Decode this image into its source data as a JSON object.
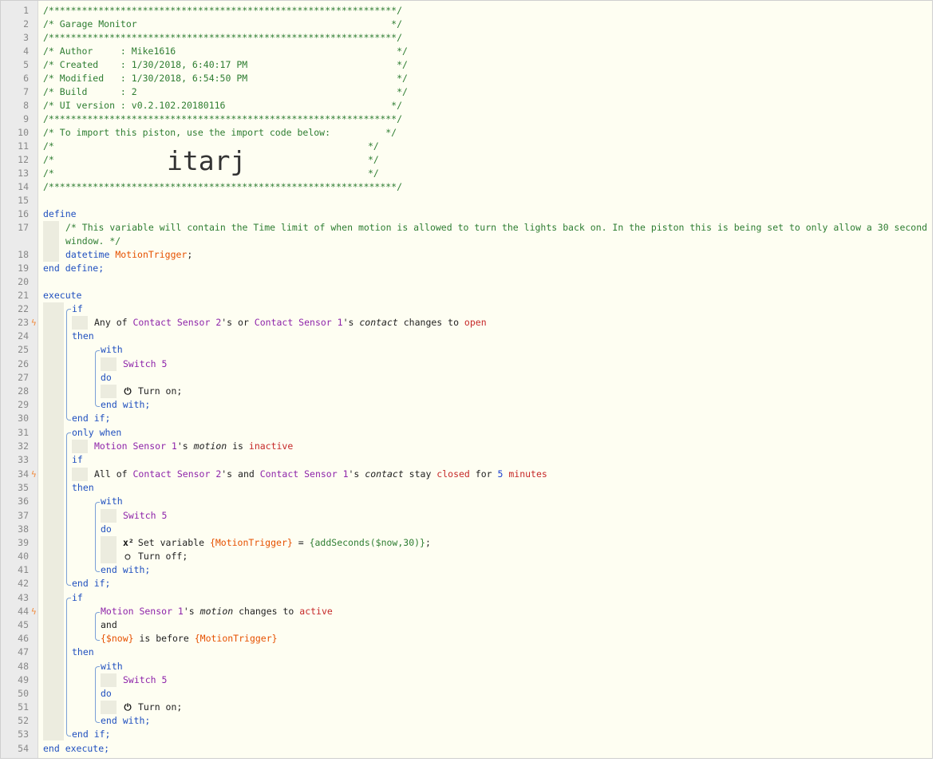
{
  "header": {
    "border": "/***************************************************************/",
    "title": "/* Garage Monitor                                              */",
    "author": "/* Author     : Mike1616                                        */",
    "created": "/* Created    : 1/30/2018, 6:40:17 PM                           */",
    "modified": "/* Modified   : 1/30/2018, 6:54:50 PM                           */",
    "build": "/* Build      : 2                                               */",
    "ui_version": "/* UI version : v0.2.102.20180116                              */",
    "import_text": "/* To import this piston, use the import code below:          */",
    "blank_open": "/*",
    "blank_close": "*/",
    "import_code": "itarj"
  },
  "define": {
    "kw_define": "define",
    "comment_line1": "/* This variable will contain the Time limit of when motion is allowed to turn the lights back on. In the piston this is being set to only allow a 30 second",
    "comment_line2": "window. */",
    "type": "datetime",
    "var_name": "MotionTrigger",
    "semicolon": ";",
    "end": "end define;"
  },
  "execute": {
    "kw_execute": "execute",
    "kw_if": "if",
    "kw_then": "then",
    "kw_with": "with",
    "kw_do": "do",
    "kw_end_with": "end with;",
    "kw_end_if": "end if;",
    "kw_only_when": "only when",
    "kw_and": "and",
    "end": "end execute;",
    "block1": {
      "pre": "Any of ",
      "dev1": "Contact Sensor 2",
      "mid1": "'s or ",
      "dev2": "Contact Sensor 1",
      "mid2": "'s ",
      "attr": "contact",
      "mid3": " changes to ",
      "value": "open",
      "device": "Switch 5",
      "action": "Turn on;"
    },
    "block2": {
      "ow_dev": "Motion Sensor 1",
      "ow_mid": "'s ",
      "ow_attr": "motion",
      "ow_is": " is ",
      "ow_value": "inactive",
      "pre": "All of ",
      "dev1": "Contact Sensor 2",
      "mid1": "'s and ",
      "dev2": "Contact Sensor 1",
      "mid2": "'s ",
      "attr": "contact",
      "mid3": " stay ",
      "value": "closed",
      "for": " for ",
      "dur_num": "5",
      "dur_unit": "minutes",
      "device": "Switch 5",
      "set_icon": "x²",
      "set_text": " Set variable ",
      "set_var": "{MotionTrigger}",
      "set_eq": " = ",
      "set_expr": "{addSeconds($now,30)}",
      "set_end": ";",
      "action": "Turn off;"
    },
    "block3": {
      "dev": "Motion Sensor 1",
      "mid": "'s ",
      "attr": "motion",
      "mid2": " changes to ",
      "value": "active",
      "now": "{$now}",
      "before": " is before ",
      "var": "{MotionTrigger}",
      "device": "Switch 5",
      "action": "Turn on;"
    }
  },
  "icons": {
    "trigger": "lightning-bolt-icon",
    "power_on": "power-icon",
    "power_off": "circle-off-icon",
    "variable": "variable-icon"
  },
  "colors": {
    "comment": "#2e7d32",
    "keyword": "#1f4fbf",
    "device": "#8e24aa",
    "value": "#c62828",
    "variable": "#e65100",
    "trigger_bolt": "#f08a3c"
  }
}
